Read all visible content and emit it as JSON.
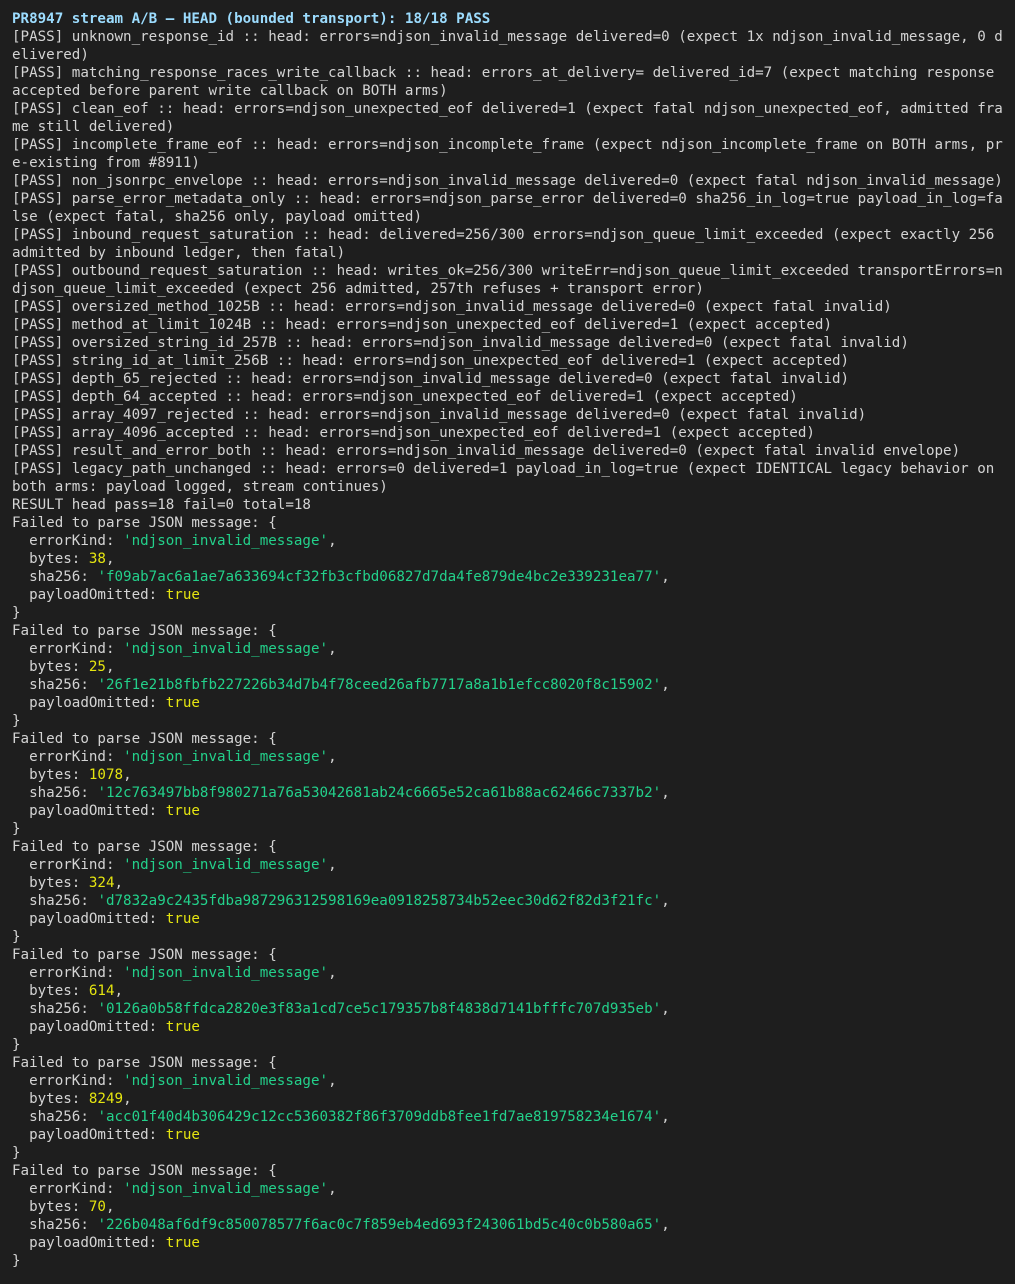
{
  "terminal": {
    "header": "PR8947 stream A/B — HEAD (bounded transport): 18/18 PASS",
    "results": [
      "[PASS] unknown_response_id :: head: errors=ndjson_invalid_message delivered=0 (expect 1x ndjson_invalid_message, 0 delivered)",
      "[PASS] matching_response_races_write_callback :: head: errors_at_delivery= delivered_id=7 (expect matching response accepted before parent write callback on BOTH arms)",
      "[PASS] clean_eof :: head: errors=ndjson_unexpected_eof delivered=1 (expect fatal ndjson_unexpected_eof, admitted frame still delivered)",
      "[PASS] incomplete_frame_eof :: head: errors=ndjson_incomplete_frame (expect ndjson_incomplete_frame on BOTH arms, pre-existing from #8911)",
      "[PASS] non_jsonrpc_envelope :: head: errors=ndjson_invalid_message delivered=0 (expect fatal ndjson_invalid_message)",
      "[PASS] parse_error_metadata_only :: head: errors=ndjson_parse_error delivered=0 sha256_in_log=true payload_in_log=false (expect fatal, sha256 only, payload omitted)",
      "[PASS] inbound_request_saturation :: head: delivered=256/300 errors=ndjson_queue_limit_exceeded (expect exactly 256 admitted by inbound ledger, then fatal)",
      "[PASS] outbound_request_saturation :: head: writes_ok=256/300 writeErr=ndjson_queue_limit_exceeded transportErrors=ndjson_queue_limit_exceeded (expect 256 admitted, 257th refuses + transport error)",
      "[PASS] oversized_method_1025B :: head: errors=ndjson_invalid_message delivered=0 (expect fatal invalid)",
      "[PASS] method_at_limit_1024B :: head: errors=ndjson_unexpected_eof delivered=1 (expect accepted)",
      "[PASS] oversized_string_id_257B :: head: errors=ndjson_invalid_message delivered=0 (expect fatal invalid)",
      "[PASS] string_id_at_limit_256B :: head: errors=ndjson_unexpected_eof delivered=1 (expect accepted)",
      "[PASS] depth_65_rejected :: head: errors=ndjson_invalid_message delivered=0 (expect fatal invalid)",
      "[PASS] depth_64_accepted :: head: errors=ndjson_unexpected_eof delivered=1 (expect accepted)",
      "[PASS] array_4097_rejected :: head: errors=ndjson_invalid_message delivered=0 (expect fatal invalid)",
      "[PASS] array_4096_accepted :: head: errors=ndjson_unexpected_eof delivered=1 (expect accepted)",
      "[PASS] result_and_error_both :: head: errors=ndjson_invalid_message delivered=0 (expect fatal invalid envelope)",
      "[PASS] legacy_path_unchanged :: head: errors=0 delivered=1 payload_in_log=true (expect IDENTICAL legacy behavior on both arms: payload logged, stream continues)"
    ],
    "summary": "RESULT head pass=18 fail=0 total=18",
    "block_labels": {
      "open": "Failed to parse JSON message: {",
      "error_kind_key": "  errorKind: ",
      "bytes_key": "  bytes: ",
      "sha_key": "  sha256: ",
      "payload_key": "  payloadOmitted: ",
      "comma": ",",
      "close": "}"
    },
    "errors": [
      {
        "errorKind": "'ndjson_invalid_message'",
        "bytes": "38",
        "sha256": "'f09ab7ac6a1ae7a633694cf32fb3cfbd06827d7da4fe879de4bc2e339231ea77'",
        "payloadOmitted": "true"
      },
      {
        "errorKind": "'ndjson_invalid_message'",
        "bytes": "25",
        "sha256": "'26f1e21b8fbfb227226b34d7b4f78ceed26afb7717a8a1b1efcc8020f8c15902'",
        "payloadOmitted": "true"
      },
      {
        "errorKind": "'ndjson_invalid_message'",
        "bytes": "1078",
        "sha256": "'12c763497bb8f980271a76a53042681ab24c6665e52ca61b88ac62466c7337b2'",
        "payloadOmitted": "true"
      },
      {
        "errorKind": "'ndjson_invalid_message'",
        "bytes": "324",
        "sha256": "'d7832a9c2435fdba987296312598169ea0918258734b52eec30d62f82d3f21fc'",
        "payloadOmitted": "true"
      },
      {
        "errorKind": "'ndjson_invalid_message'",
        "bytes": "614",
        "sha256": "'0126a0b58ffdca2820e3f83a1cd7ce5c179357b8f4838d7141bfffc707d935eb'",
        "payloadOmitted": "true"
      },
      {
        "errorKind": "'ndjson_invalid_message'",
        "bytes": "8249",
        "sha256": "'acc01f40d4b306429c12cc5360382f86f3709ddb8fee1fd7ae819758234e1674'",
        "payloadOmitted": "true"
      },
      {
        "errorKind": "'ndjson_invalid_message'",
        "bytes": "70",
        "sha256": "'226b048af6df9c850078577f6ac0c7f859eb4ed693f243061bd5c40c0b580a65'",
        "payloadOmitted": "true"
      }
    ],
    "colors": {
      "background": "#1e1e1e",
      "text": "#d4d4d4",
      "header": "#9cdcfe",
      "string": "#23d18b",
      "number": "#e5e510"
    }
  }
}
